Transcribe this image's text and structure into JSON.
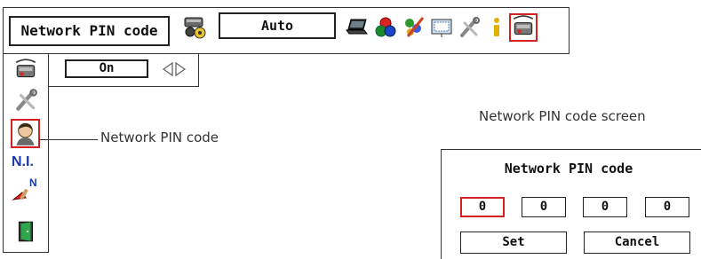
{
  "menu_bar": {
    "title": "Network PIN code",
    "source_value": "Auto",
    "icons": [
      "input-icon",
      "pc-adjust-icon",
      "color-icon",
      "image-icon",
      "screen-icon",
      "setting-icon",
      "information-icon",
      "network-icon"
    ]
  },
  "sidebar": {
    "items": [
      "network-icon",
      "setting-icon",
      "network-pin-code-icon",
      "network-information-icon",
      "network-factory-default-icon",
      "exit-icon"
    ],
    "selected": "network-pin-code-icon",
    "ni_label": "N.I.",
    "n_label": "N"
  },
  "value_panel": {
    "value": "On"
  },
  "callout": {
    "label": "Network PIN code"
  },
  "pin_screen": {
    "caption": "Network PIN code screen",
    "title": "Network PIN code",
    "digits": [
      "0",
      "0",
      "0",
      "0"
    ],
    "set_label": "Set",
    "cancel_label": "Cancel"
  },
  "colors": {
    "selection": "#d32020",
    "border": "#222222"
  }
}
